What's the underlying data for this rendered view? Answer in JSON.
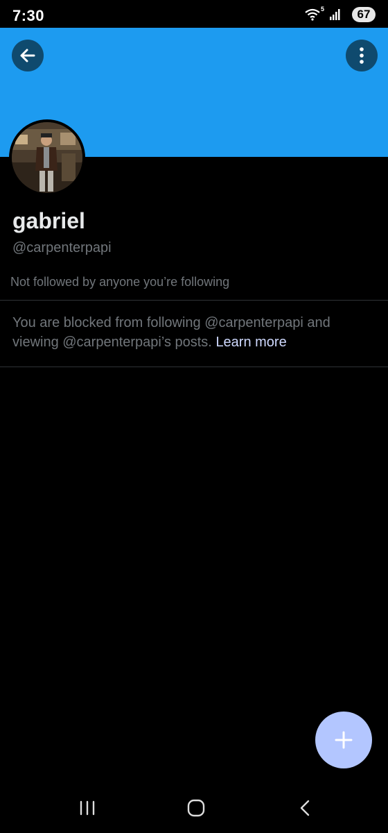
{
  "status_bar": {
    "time": "7:30",
    "wifi_label": "5",
    "battery": "67",
    "icons": [
      "wifi-icon",
      "signal-icon"
    ]
  },
  "header": {
    "banner_color": "#1d9bf0",
    "back_icon": "arrow-left-icon",
    "more_icon": "more-vertical-icon"
  },
  "profile": {
    "display_name": "gabriel",
    "handle": "@carpenterpapi",
    "followed_by": "Not followed by anyone you’re following",
    "blocked_message": "You are blocked from following @carpenterpapi and viewing @carpenterpapi’s posts.",
    "learn_more": "Learn more"
  },
  "fab": {
    "icon": "plus-icon",
    "color": "#b3c6ff"
  },
  "nav_bar": {
    "items": [
      "recent-apps-icon",
      "home-icon",
      "back-icon"
    ]
  }
}
